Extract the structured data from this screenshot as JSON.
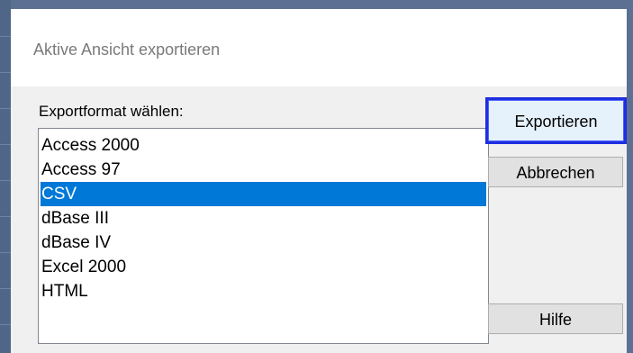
{
  "window": {
    "title": "Aktive Ansicht exportieren"
  },
  "format_section": {
    "label": "Exportformat wählen:",
    "items": [
      {
        "label": "Access 2000",
        "selected": false
      },
      {
        "label": "Access 97",
        "selected": false
      },
      {
        "label": "CSV",
        "selected": true
      },
      {
        "label": "dBase III",
        "selected": false
      },
      {
        "label": "dBase IV",
        "selected": false
      },
      {
        "label": "Excel 2000",
        "selected": false
      },
      {
        "label": "HTML",
        "selected": false
      }
    ]
  },
  "buttons": {
    "export_label": "Exportieren",
    "cancel_label": "Abbrechen",
    "help_label": "Hilfe"
  },
  "colors": {
    "selection": "#0078d7",
    "default_button_border": "#1f2ee0",
    "dialog_background": "#f0f0f0",
    "title_text": "#7a7a7a"
  }
}
